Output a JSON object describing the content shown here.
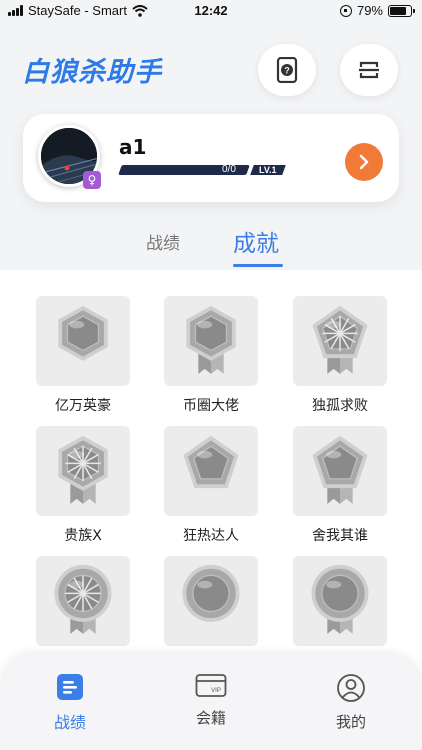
{
  "status_bar": {
    "carrier": "StaySafe - Smart",
    "time": "12:42",
    "battery": "79%",
    "battery_level": 0.79
  },
  "header": {
    "title": "白狼杀助手",
    "help_icon": "help-card-icon",
    "scan_icon": "scan-icon"
  },
  "profile": {
    "username": "a1",
    "xp_text": "0/0",
    "xp_progress": 0.0,
    "level": "LV.1",
    "gender_icon": "♀",
    "gender_color": "#a35ad6"
  },
  "tabs": {
    "record": "战绩",
    "achievement": "成就",
    "active": "achievement"
  },
  "achievements": [
    {
      "label": "亿万英豪",
      "shape": "hexagon"
    },
    {
      "label": "币圈大佬",
      "shape": "hexagon-ribbon"
    },
    {
      "label": "独孤求败",
      "shape": "pentagon-burst"
    },
    {
      "label": "贵族X",
      "shape": "hexagon-burst"
    },
    {
      "label": "狂热达人",
      "shape": "pentagon"
    },
    {
      "label": "舍我其谁",
      "shape": "pentagon-ribbon"
    },
    {
      "label": "",
      "shape": "circle-burst"
    },
    {
      "label": "",
      "shape": "circle"
    },
    {
      "label": "",
      "shape": "circle-ribbon"
    }
  ],
  "bottom_nav": [
    {
      "label": "战绩",
      "icon": "record-icon",
      "active": true
    },
    {
      "label": "会籍",
      "icon": "vip-card-icon",
      "active": false
    },
    {
      "label": "我的",
      "icon": "user-icon",
      "active": false
    }
  ],
  "colors": {
    "accent": "#3b7ee8",
    "title_blue": "#2e7ae6",
    "go_button": "#f07a36",
    "xp_bar": "#1d2b48"
  }
}
